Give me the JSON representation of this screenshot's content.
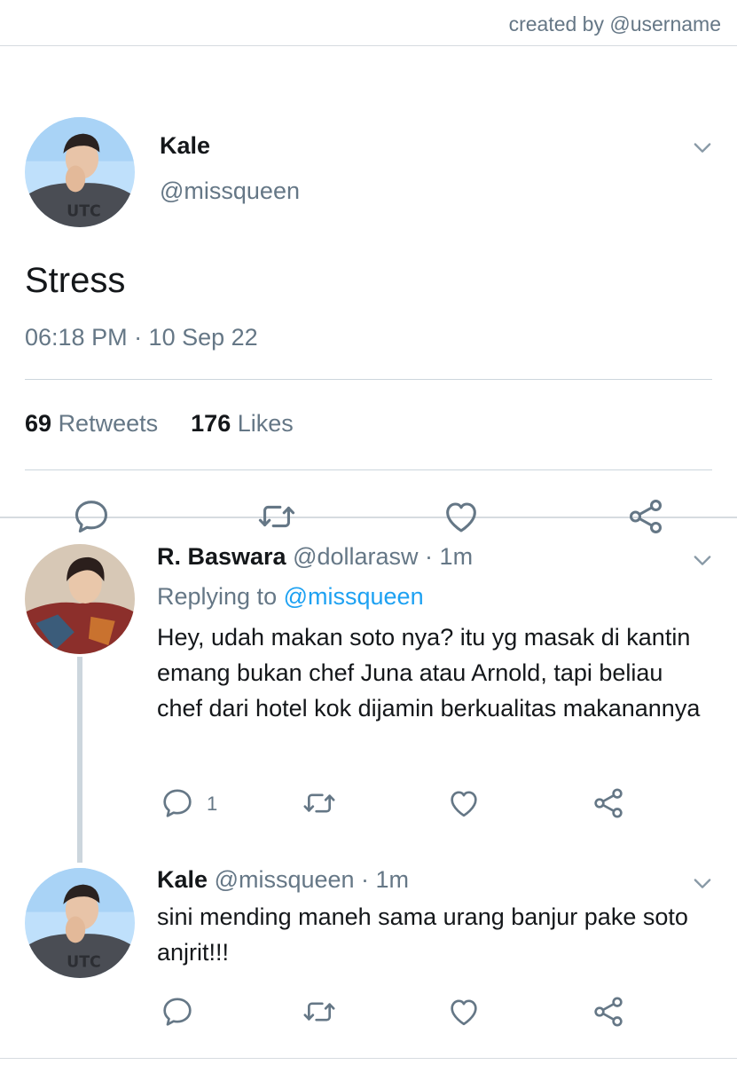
{
  "header": {
    "credit": "created by @username"
  },
  "tweet": {
    "name": "Kale",
    "handle": "@missqueen",
    "text": "Stress",
    "timestamp": "06:18 PM · 10 Sep 22",
    "retweets_count": "69",
    "retweets_label": "Retweets",
    "likes_count": "176",
    "likes_label": "Likes",
    "actions": [
      "reply-icon",
      "retweet-icon",
      "like-icon",
      "share-icon"
    ]
  },
  "replies": [
    {
      "name": "R. Baswara",
      "meta": "@dollarasw · 1m",
      "replying_prefix": "Replying to",
      "replying_to": "@missqueen",
      "text": "Hey, udah makan soto nya? itu yg masak di kantin emang bukan chef Juna atau Arnold, tapi beliau chef dari hotel kok dijamin berkualitas makanannya",
      "reply_count": "1"
    },
    {
      "name": "Kale",
      "meta": "@missqueen · 1m",
      "text": "sini mending maneh sama urang banjur pake soto anjrit!!!"
    }
  ],
  "colors": {
    "accent": "#1da1f2",
    "secondary": "#657786",
    "icon": "#657786",
    "divider": "#ccd6dd"
  }
}
